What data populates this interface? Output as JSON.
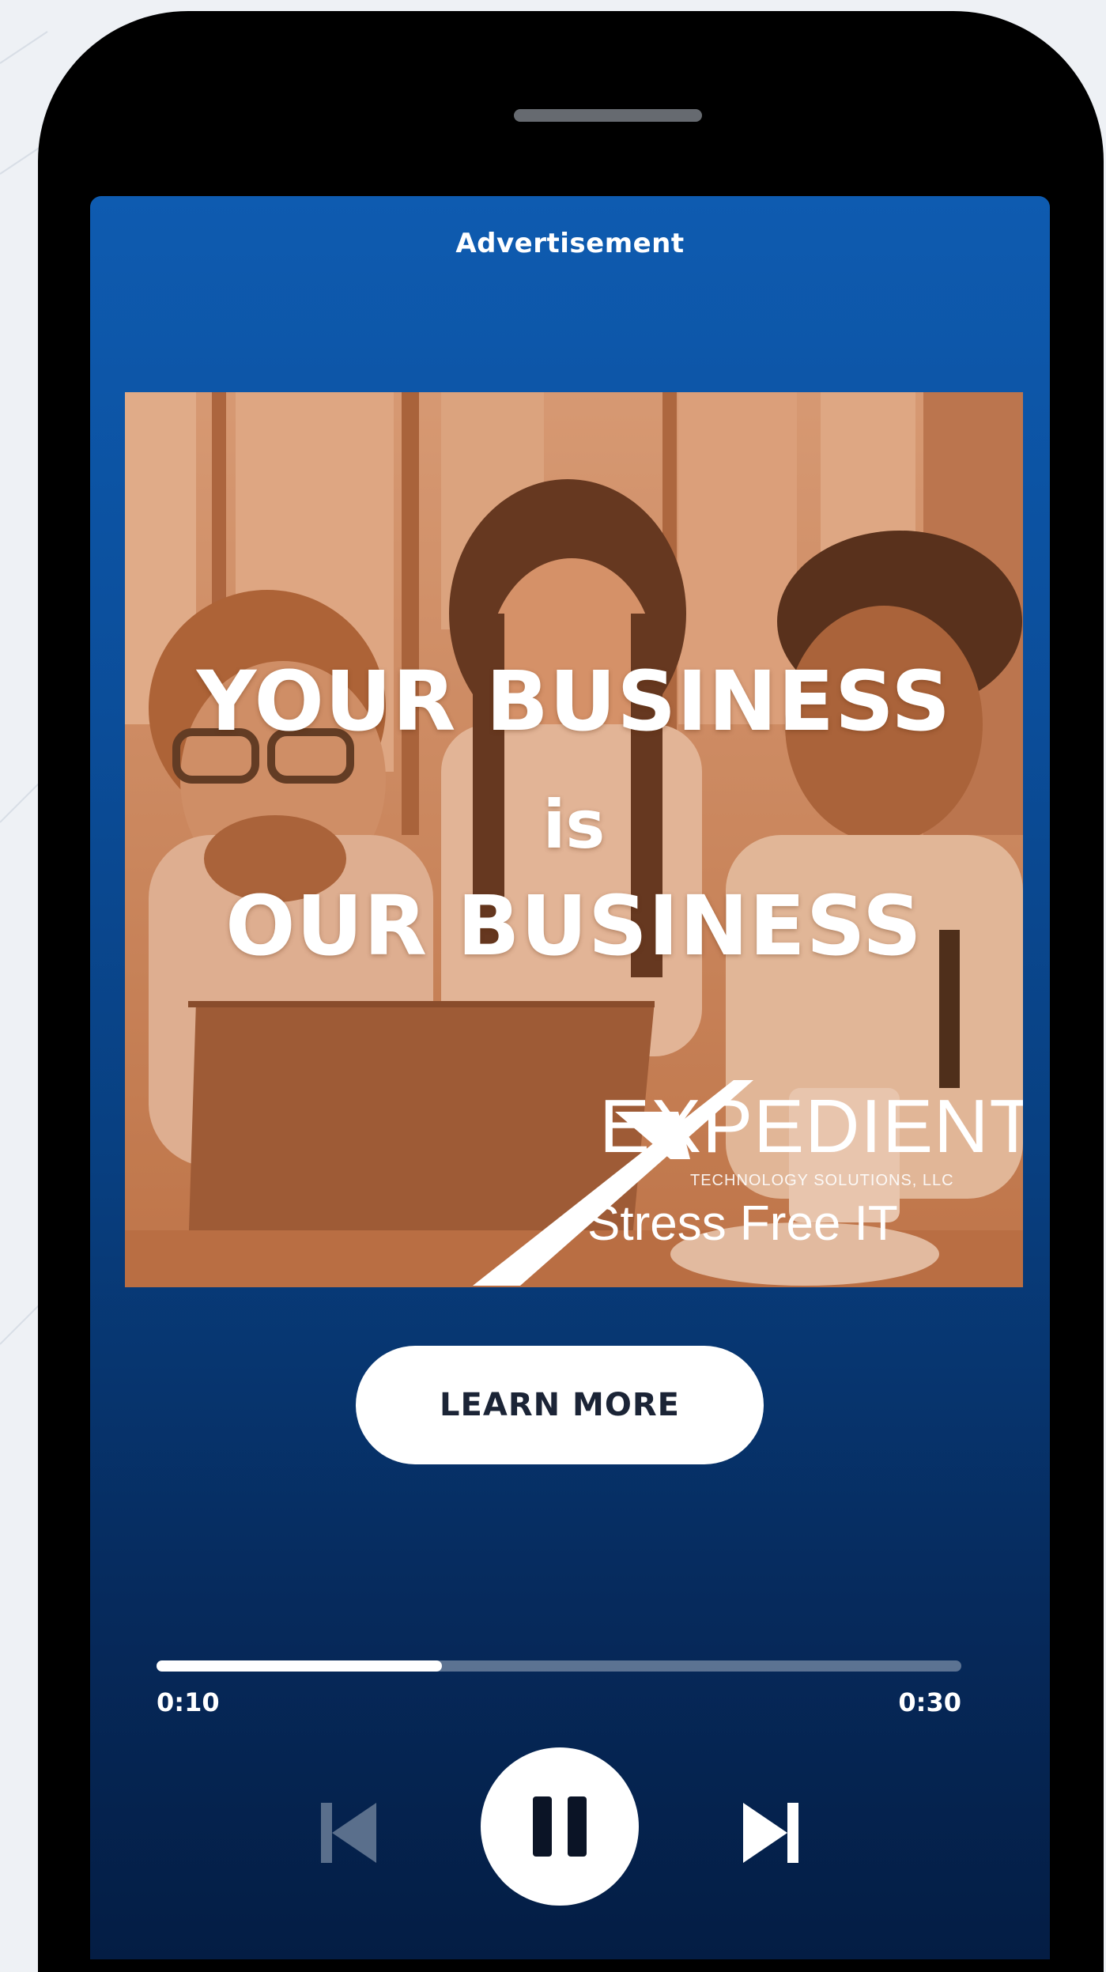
{
  "ad": {
    "label": "Advertisement",
    "headline_line1": "YOUR BUSINESS",
    "headline_line2": "is",
    "headline_line3": "OUR BUSINESS",
    "brand": {
      "name": "EXPEDIENT",
      "subtitle": "TECHNOLOGY SOLUTIONS, LLC",
      "tagline": "Stress Free IT"
    },
    "cta_label": "LEARN MORE"
  },
  "player": {
    "elapsed": "0:10",
    "total": "0:30",
    "progress_fraction": 0.355,
    "controls": {
      "previous_icon": "skip-previous-icon",
      "pause_icon": "pause-icon",
      "next_icon": "skip-next-icon"
    }
  },
  "colors": {
    "screen_top": "#0e5bb0",
    "screen_bottom": "#041d44",
    "photo_tint": "#c98a64"
  }
}
